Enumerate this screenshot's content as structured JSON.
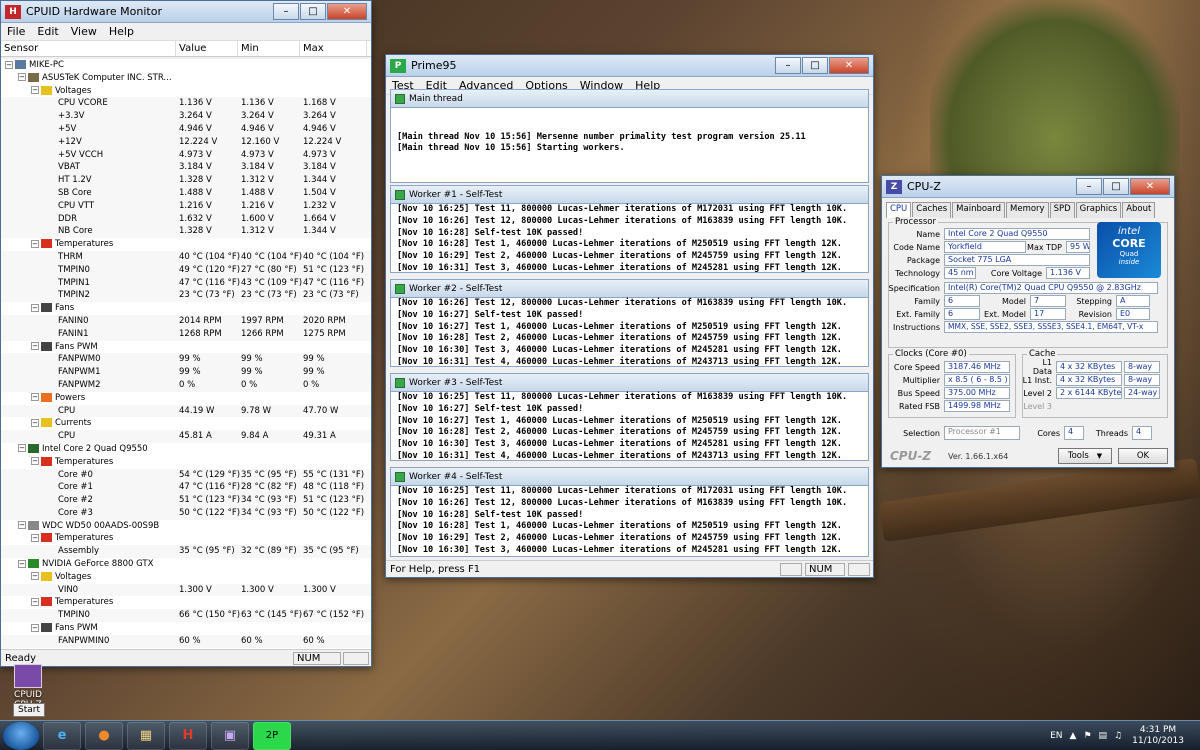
{
  "hwm": {
    "title": "CPUID Hardware Monitor",
    "menu": [
      "File",
      "Edit",
      "View",
      "Help"
    ],
    "columns": [
      "Sensor",
      "Value",
      "Min",
      "Max"
    ],
    "rows": [
      {
        "level": 0,
        "type": "node",
        "icon": "computer",
        "name": "MIKE-PC"
      },
      {
        "level": 1,
        "type": "node",
        "icon": "board",
        "name": "ASUSTeK Computer INC. STR..."
      },
      {
        "level": 2,
        "type": "node",
        "icon": "volt",
        "name": "Voltages"
      },
      {
        "level": 3,
        "type": "s",
        "name": "CPU VCORE",
        "v": "1.136 V",
        "mn": "1.136 V",
        "mx": "1.168 V"
      },
      {
        "level": 3,
        "type": "s",
        "name": "+3.3V",
        "v": "3.264 V",
        "mn": "3.264 V",
        "mx": "3.264 V"
      },
      {
        "level": 3,
        "type": "s",
        "name": "+5V",
        "v": "4.946 V",
        "mn": "4.946 V",
        "mx": "4.946 V"
      },
      {
        "level": 3,
        "type": "s",
        "name": "+12V",
        "v": "12.224 V",
        "mn": "12.160 V",
        "mx": "12.224 V"
      },
      {
        "level": 3,
        "type": "s",
        "name": "+5V VCCH",
        "v": "4.973 V",
        "mn": "4.973 V",
        "mx": "4.973 V"
      },
      {
        "level": 3,
        "type": "s",
        "name": "VBAT",
        "v": "3.184 V",
        "mn": "3.184 V",
        "mx": "3.184 V"
      },
      {
        "level": 3,
        "type": "s",
        "name": "HT 1.2V",
        "v": "1.328 V",
        "mn": "1.312 V",
        "mx": "1.344 V"
      },
      {
        "level": 3,
        "type": "s",
        "name": "SB Core",
        "v": "1.488 V",
        "mn": "1.488 V",
        "mx": "1.504 V"
      },
      {
        "level": 3,
        "type": "s",
        "name": "CPU VTT",
        "v": "1.216 V",
        "mn": "1.216 V",
        "mx": "1.232 V"
      },
      {
        "level": 3,
        "type": "s",
        "name": "DDR",
        "v": "1.632 V",
        "mn": "1.600 V",
        "mx": "1.664 V"
      },
      {
        "level": 3,
        "type": "s",
        "name": "NB Core",
        "v": "1.328 V",
        "mn": "1.312 V",
        "mx": "1.344 V"
      },
      {
        "level": 2,
        "type": "node",
        "icon": "temp",
        "name": "Temperatures"
      },
      {
        "level": 3,
        "type": "s",
        "name": "THRM",
        "v": "40 °C (104 °F)",
        "mn": "40 °C (104 °F)",
        "mx": "40 °C (104 °F)"
      },
      {
        "level": 3,
        "type": "s",
        "name": "TMPIN0",
        "v": "49 °C (120 °F)",
        "mn": "27 °C (80 °F)",
        "mx": "51 °C (123 °F)"
      },
      {
        "level": 3,
        "type": "s",
        "name": "TMPIN1",
        "v": "47 °C (116 °F)",
        "mn": "43 °C (109 °F)",
        "mx": "47 °C (116 °F)"
      },
      {
        "level": 3,
        "type": "s",
        "name": "TMPIN2",
        "v": "23 °C (73 °F)",
        "mn": "23 °C (73 °F)",
        "mx": "23 °C (73 °F)"
      },
      {
        "level": 2,
        "type": "node",
        "icon": "fan",
        "name": "Fans"
      },
      {
        "level": 3,
        "type": "s",
        "name": "FANIN0",
        "v": "2014 RPM",
        "mn": "1997 RPM",
        "mx": "2020 RPM"
      },
      {
        "level": 3,
        "type": "s",
        "name": "FANIN1",
        "v": "1268 RPM",
        "mn": "1266 RPM",
        "mx": "1275 RPM"
      },
      {
        "level": 2,
        "type": "node",
        "icon": "fan",
        "name": "Fans PWM"
      },
      {
        "level": 3,
        "type": "s",
        "name": "FANPWM0",
        "v": "99 %",
        "mn": "99 %",
        "mx": "99 %"
      },
      {
        "level": 3,
        "type": "s",
        "name": "FANPWM1",
        "v": "99 %",
        "mn": "99 %",
        "mx": "99 %"
      },
      {
        "level": 3,
        "type": "s",
        "name": "FANPWM2",
        "v": "0 %",
        "mn": "0 %",
        "mx": "0 %"
      },
      {
        "level": 2,
        "type": "node",
        "icon": "power",
        "name": "Powers"
      },
      {
        "level": 3,
        "type": "s",
        "name": "CPU",
        "v": "44.19 W",
        "mn": "9.78 W",
        "mx": "47.70 W"
      },
      {
        "level": 2,
        "type": "node",
        "icon": "volt",
        "name": "Currents"
      },
      {
        "level": 3,
        "type": "s",
        "name": "CPU",
        "v": "45.81 A",
        "mn": "9.84 A",
        "mx": "49.31 A"
      },
      {
        "level": 1,
        "type": "node",
        "icon": "chip",
        "name": "Intel Core 2 Quad Q9550"
      },
      {
        "level": 2,
        "type": "node",
        "icon": "temp",
        "name": "Temperatures"
      },
      {
        "level": 3,
        "type": "s",
        "name": "Core #0",
        "v": "54 °C (129 °F)",
        "mn": "35 °C (95 °F)",
        "mx": "55 °C (131 °F)"
      },
      {
        "level": 3,
        "type": "s",
        "name": "Core #1",
        "v": "47 °C (116 °F)",
        "mn": "28 °C (82 °F)",
        "mx": "48 °C (118 °F)"
      },
      {
        "level": 3,
        "type": "s",
        "name": "Core #2",
        "v": "51 °C (123 °F)",
        "mn": "34 °C (93 °F)",
        "mx": "51 °C (123 °F)"
      },
      {
        "level": 3,
        "type": "s",
        "name": "Core #3",
        "v": "50 °C (122 °F)",
        "mn": "34 °C (93 °F)",
        "mx": "50 °C (122 °F)"
      },
      {
        "level": 1,
        "type": "node",
        "icon": "disk",
        "name": "WDC WD50 00AADS-00S9B"
      },
      {
        "level": 2,
        "type": "node",
        "icon": "temp",
        "name": "Temperatures"
      },
      {
        "level": 3,
        "type": "s",
        "name": "Assembly",
        "v": "35 °C (95 °F)",
        "mn": "32 °C (89 °F)",
        "mx": "35 °C (95 °F)"
      },
      {
        "level": 1,
        "type": "node",
        "icon": "gpu",
        "name": "NVIDIA GeForce 8800 GTX"
      },
      {
        "level": 2,
        "type": "node",
        "icon": "volt",
        "name": "Voltages"
      },
      {
        "level": 3,
        "type": "s",
        "name": "VIN0",
        "v": "1.300 V",
        "mn": "1.300 V",
        "mx": "1.300 V"
      },
      {
        "level": 2,
        "type": "node",
        "icon": "temp",
        "name": "Temperatures"
      },
      {
        "level": 3,
        "type": "s",
        "name": "TMPIN0",
        "v": "66 °C (150 °F)",
        "mn": "63 °C (145 °F)",
        "mx": "67 °C (152 °F)"
      },
      {
        "level": 2,
        "type": "node",
        "icon": "fan",
        "name": "Fans PWM"
      },
      {
        "level": 3,
        "type": "s",
        "name": "FANPWMIN0",
        "v": "60 %",
        "mn": "60 %",
        "mx": "60 %"
      }
    ],
    "status_left": "Ready",
    "status_num": "NUM"
  },
  "prime95": {
    "title": "Prime95",
    "menu": [
      "Test",
      "Edit",
      "Advanced",
      "Options",
      "Window",
      "Help"
    ],
    "panes": [
      {
        "title": "Main thread",
        "lines": [
          "",
          "",
          "[Main thread Nov 10 15:56] Mersenne number primality test program version 25.11",
          "[Main thread Nov 10 15:56] Starting workers."
        ]
      },
      {
        "title": "Worker #1 - Self-Test",
        "lines": [
          "[Nov 10 16:25] Test 11, 800000 Lucas-Lehmer iterations of M172031 using FFT length 10K.",
          "[Nov 10 16:26] Test 12, 800000 Lucas-Lehmer iterations of M163839 using FFT length 10K.",
          "[Nov 10 16:28] Self-test 10K passed!",
          "[Nov 10 16:28] Test 1, 460000 Lucas-Lehmer iterations of M250519 using FFT length 12K.",
          "[Nov 10 16:29] Test 2, 460000 Lucas-Lehmer iterations of M245759 using FFT length 12K.",
          "[Nov 10 16:31] Test 3, 460000 Lucas-Lehmer iterations of M245281 using FFT length 12K."
        ]
      },
      {
        "title": "Worker #2 - Self-Test",
        "lines": [
          "[Nov 10 16:26] Test 12, 800000 Lucas-Lehmer iterations of M163839 using FFT length 10K.",
          "[Nov 10 16:27] Self-test 10K passed!",
          "[Nov 10 16:27] Test 1, 460000 Lucas-Lehmer iterations of M250519 using FFT length 12K.",
          "[Nov 10 16:28] Test 2, 460000 Lucas-Lehmer iterations of M245759 using FFT length 12K.",
          "[Nov 10 16:30] Test 3, 460000 Lucas-Lehmer iterations of M245281 using FFT length 12K.",
          "[Nov 10 16:31] Test 4, 460000 Lucas-Lehmer iterations of M243713 using FFT length 12K."
        ]
      },
      {
        "title": "Worker #3 - Self-Test",
        "lines": [
          "[Nov 10 16:25] Test 11, 800000 Lucas-Lehmer iterations of M163839 using FFT length 10K.",
          "[Nov 10 16:27] Self-test 10K passed!",
          "[Nov 10 16:27] Test 1, 460000 Lucas-Lehmer iterations of M250519 using FFT length 12K.",
          "[Nov 10 16:28] Test 2, 460000 Lucas-Lehmer iterations of M245759 using FFT length 12K.",
          "[Nov 10 16:30] Test 3, 460000 Lucas-Lehmer iterations of M245281 using FFT length 12K.",
          "[Nov 10 16:31] Test 4, 460000 Lucas-Lehmer iterations of M243713 using FFT length 12K."
        ]
      },
      {
        "title": "Worker #4 - Self-Test",
        "lines": [
          "[Nov 10 16:25] Test 11, 800000 Lucas-Lehmer iterations of M172031 using FFT length 10K.",
          "[Nov 10 16:26] Test 12, 800000 Lucas-Lehmer iterations of M163839 using FFT length 10K.",
          "[Nov 10 16:28] Self-test 10K passed!",
          "[Nov 10 16:28] Test 1, 460000 Lucas-Lehmer iterations of M250519 using FFT length 12K.",
          "[Nov 10 16:29] Test 2, 460000 Lucas-Lehmer iterations of M245759 using FFT length 12K.",
          "[Nov 10 16:30] Test 3, 460000 Lucas-Lehmer iterations of M245281 using FFT length 12K."
        ]
      }
    ],
    "status_left": "For Help, press F1",
    "status_num": "NUM"
  },
  "cpuz": {
    "title": "CPU-Z",
    "tabs": [
      "CPU",
      "Caches",
      "Mainboard",
      "Memory",
      "SPD",
      "Graphics",
      "About"
    ],
    "processor_label": "Processor",
    "name_label": "Name",
    "name": "Intel Core 2 Quad Q9550",
    "codename_label": "Code Name",
    "codename": "Yorkfield",
    "maxtdp_label": "Max TDP",
    "maxtdp": "95 W",
    "package_label": "Package",
    "package": "Socket 775 LGA",
    "technology_label": "Technology",
    "technology": "45 nm",
    "corevoltage_label": "Core Voltage",
    "corevoltage": "1.136 V",
    "spec_label": "Specification",
    "spec": "Intel(R) Core(TM)2 Quad CPU    Q9550  @ 2.83GHz",
    "family_label": "Family",
    "family": "6",
    "model_label": "Model",
    "model": "7",
    "stepping_label": "Stepping",
    "stepping": "A",
    "extfamily_label": "Ext. Family",
    "extfamily": "6",
    "extmodel_label": "Ext. Model",
    "extmodel": "17",
    "revision_label": "Revision",
    "revision": "E0",
    "instr_label": "Instructions",
    "instr": "MMX, SSE, SSE2, SSE3, SSSE3, SSE4.1, EM64T, VT-x",
    "clocks_label": "Clocks (Core #0)",
    "corespeed_label": "Core Speed",
    "corespeed": "3187.46 MHz",
    "multiplier_label": "Multiplier",
    "multiplier": "x 8.5 ( 6 - 8.5 )",
    "busspeed_label": "Bus Speed",
    "busspeed": "375.00 MHz",
    "ratedfsb_label": "Rated FSB",
    "ratedfsb": "1499.98 MHz",
    "cache_label": "Cache",
    "l1d_label": "L1 Data",
    "l1d": "4 x 32 KBytes",
    "l1d_way": "8-way",
    "l1i_label": "L1 Inst.",
    "l1i": "4 x 32 KBytes",
    "l1i_way": "8-way",
    "l2_label": "Level 2",
    "l2": "2 x 6144 KBytes",
    "l2_way": "24-way",
    "l3_label": "Level 3",
    "selection_label": "Selection",
    "selection": "Processor #1",
    "cores_label": "Cores",
    "cores": "4",
    "threads_label": "Threads",
    "threads": "4",
    "brand": "CPU-Z",
    "version": "Ver. 1.66.1.x64",
    "tools_label": "Tools",
    "ok_label": "OK",
    "logo_top": "intel",
    "logo_mid": "CORE",
    "logo_sub": "Quad",
    "logo_inside": "inside"
  },
  "desktop": {
    "icon_label": "CPUID CPU-Z",
    "start_tip": "Start"
  },
  "taskbar": {
    "lang": "EN",
    "time": "4:31 PM",
    "date": "11/10/2013"
  }
}
